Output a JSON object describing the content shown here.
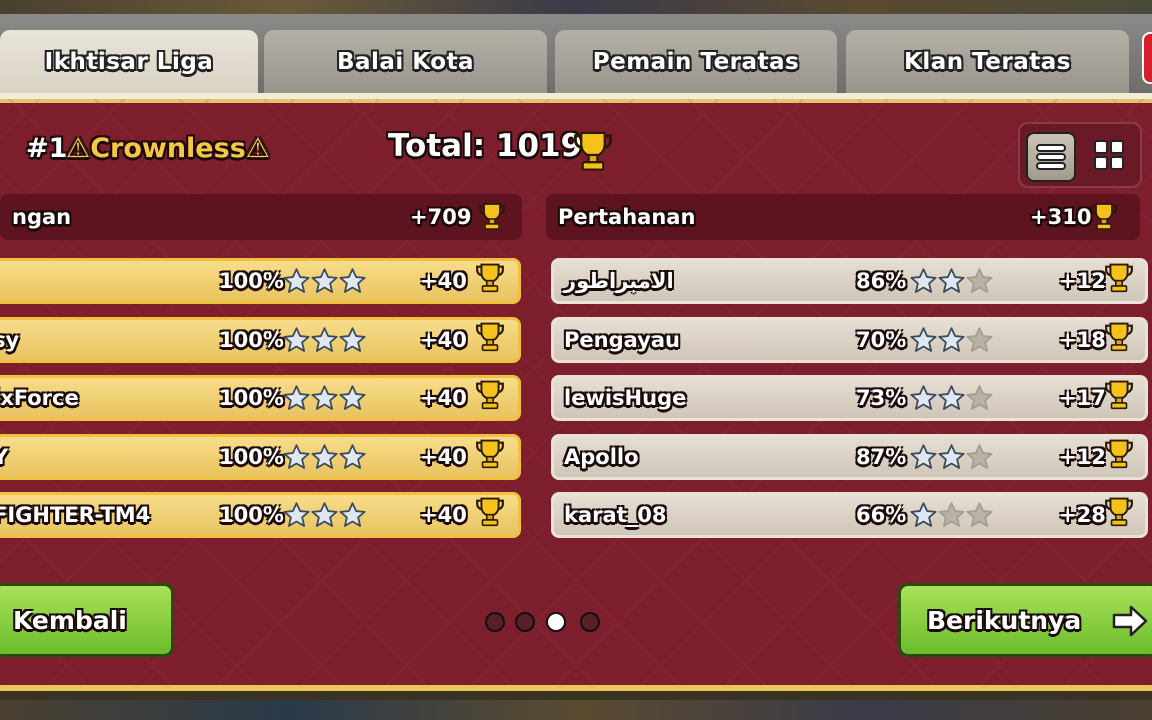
{
  "tabs": [
    {
      "label": "Ikhtisar Liga",
      "active": true
    },
    {
      "label": "Balai Kota",
      "active": false
    },
    {
      "label": "Pemain Teratas",
      "active": false
    },
    {
      "label": "Klan Teratas",
      "active": false
    }
  ],
  "header": {
    "rank": "#1",
    "clan_name": "⚠Crownless⚠",
    "total_label": "Total: 1019"
  },
  "sections": {
    "attack": {
      "label": "ngan",
      "trophies": "+709"
    },
    "defense": {
      "label": "Pertahanan",
      "trophies": "+310"
    }
  },
  "attack_rows": [
    {
      "name": "",
      "percent": "100%",
      "stars": 3,
      "trophies": "+40"
    },
    {
      "name": "sy",
      "percent": "100%",
      "stars": 3,
      "trophies": "+40"
    },
    {
      "name": "ixForce",
      "percent": "100%",
      "stars": 3,
      "trophies": "+40"
    },
    {
      "name": "Y",
      "percent": "100%",
      "stars": 3,
      "trophies": "+40"
    },
    {
      "name": "FIGHTER-TM4",
      "percent": "100%",
      "stars": 3,
      "trophies": "+40"
    }
  ],
  "defense_rows": [
    {
      "name": "الامبراطور",
      "percent": "86%",
      "stars": 2,
      "trophies": "+12"
    },
    {
      "name": "Pengayau",
      "percent": "70%",
      "stars": 2,
      "trophies": "+18"
    },
    {
      "name": "lewisHuge",
      "percent": "73%",
      "stars": 2,
      "trophies": "+17"
    },
    {
      "name": "Apollo",
      "percent": "87%",
      "stars": 2,
      "trophies": "+12"
    },
    {
      "name": "karat_08",
      "percent": "66%",
      "stars": 1,
      "trophies": "+28"
    }
  ],
  "buttons": {
    "back": "Kembali",
    "next": "Berikutnya"
  },
  "pagination": {
    "pages": 4,
    "current": 3
  },
  "icons": {
    "trophy": "trophy-icon",
    "star": "star-icon",
    "list_view": "list-view-icon",
    "grid_view": "grid-view-icon",
    "next_arrow": "arrow-right-icon"
  },
  "colors": {
    "panel": "#7c1e2c",
    "clan_name": "#f5c842",
    "button_green": "#8fd04a",
    "attack_row": "#f2d27a",
    "defense_row": "#ddd5c8"
  }
}
